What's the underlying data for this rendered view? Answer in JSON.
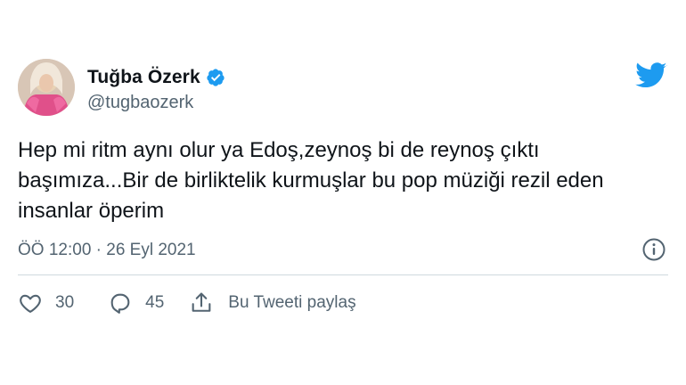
{
  "user": {
    "display_name": "Tuğba Özerk",
    "handle": "@tugbaozerk",
    "verified": true
  },
  "tweet": {
    "text": "Hep mi ritm aynı olur ya Edoş,zeynoş bi de reynoş çıktı başımıza...Bir de birliktelik kurmuşlar bu pop müziği rezil eden insanlar öperim",
    "timestamp": "ÖÖ 12:00 · 26 Eyl 2021"
  },
  "actions": {
    "like_count": "30",
    "reply_count": "45",
    "share_label": "Bu Tweeti paylaş"
  },
  "colors": {
    "brand_blue": "#1d9bf0",
    "text_primary": "#0f1419",
    "text_secondary": "#536471",
    "divider": "#cfd9de"
  },
  "icons": {
    "logo": "twitter-bird-icon",
    "verified": "verified-badge-icon",
    "info": "info-icon",
    "like": "heart-icon",
    "reply": "comment-bubble-icon",
    "share": "share-upload-icon"
  }
}
